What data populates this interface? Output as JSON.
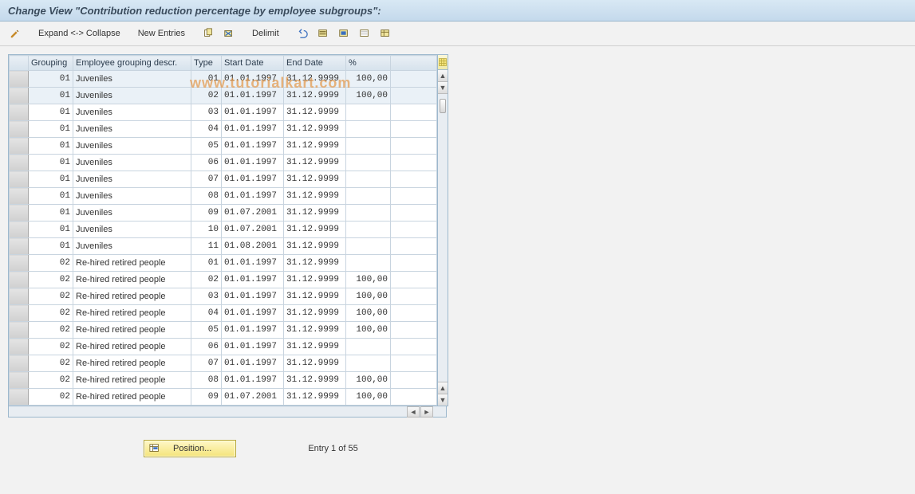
{
  "title": "Change View \"Contribution reduction percentage by employee subgroups\":",
  "watermark": "www.tutorialkart.com",
  "toolbar": {
    "expand_collapse": "Expand <-> Collapse",
    "new_entries": "New Entries",
    "delimit": "Delimit"
  },
  "columns": {
    "grouping": "Grouping",
    "descr": "Employee grouping descr.",
    "type": "Type",
    "start": "Start Date",
    "end": "End Date",
    "pct": "%"
  },
  "rows": [
    {
      "grp": "01",
      "descr": "Juveniles",
      "type": "01",
      "start": "01.01.1997",
      "end": "31.12.9999",
      "pct": "100,00"
    },
    {
      "grp": "01",
      "descr": "Juveniles",
      "type": "02",
      "start": "01.01.1997",
      "end": "31.12.9999",
      "pct": "100,00"
    },
    {
      "grp": "01",
      "descr": "Juveniles",
      "type": "03",
      "start": "01.01.1997",
      "end": "31.12.9999",
      "pct": ""
    },
    {
      "grp": "01",
      "descr": "Juveniles",
      "type": "04",
      "start": "01.01.1997",
      "end": "31.12.9999",
      "pct": ""
    },
    {
      "grp": "01",
      "descr": "Juveniles",
      "type": "05",
      "start": "01.01.1997",
      "end": "31.12.9999",
      "pct": ""
    },
    {
      "grp": "01",
      "descr": "Juveniles",
      "type": "06",
      "start": "01.01.1997",
      "end": "31.12.9999",
      "pct": ""
    },
    {
      "grp": "01",
      "descr": "Juveniles",
      "type": "07",
      "start": "01.01.1997",
      "end": "31.12.9999",
      "pct": ""
    },
    {
      "grp": "01",
      "descr": "Juveniles",
      "type": "08",
      "start": "01.01.1997",
      "end": "31.12.9999",
      "pct": ""
    },
    {
      "grp": "01",
      "descr": "Juveniles",
      "type": "09",
      "start": "01.07.2001",
      "end": "31.12.9999",
      "pct": ""
    },
    {
      "grp": "01",
      "descr": "Juveniles",
      "type": "10",
      "start": "01.07.2001",
      "end": "31.12.9999",
      "pct": ""
    },
    {
      "grp": "01",
      "descr": "Juveniles",
      "type": "11",
      "start": "01.08.2001",
      "end": "31.12.9999",
      "pct": ""
    },
    {
      "grp": "02",
      "descr": "Re-hired retired people",
      "type": "01",
      "start": "01.01.1997",
      "end": "31.12.9999",
      "pct": ""
    },
    {
      "grp": "02",
      "descr": "Re-hired retired people",
      "type": "02",
      "start": "01.01.1997",
      "end": "31.12.9999",
      "pct": "100,00"
    },
    {
      "grp": "02",
      "descr": "Re-hired retired people",
      "type": "03",
      "start": "01.01.1997",
      "end": "31.12.9999",
      "pct": "100,00"
    },
    {
      "grp": "02",
      "descr": "Re-hired retired people",
      "type": "04",
      "start": "01.01.1997",
      "end": "31.12.9999",
      "pct": "100,00"
    },
    {
      "grp": "02",
      "descr": "Re-hired retired people",
      "type": "05",
      "start": "01.01.1997",
      "end": "31.12.9999",
      "pct": "100,00"
    },
    {
      "grp": "02",
      "descr": "Re-hired retired people",
      "type": "06",
      "start": "01.01.1997",
      "end": "31.12.9999",
      "pct": ""
    },
    {
      "grp": "02",
      "descr": "Re-hired retired people",
      "type": "07",
      "start": "01.01.1997",
      "end": "31.12.9999",
      "pct": ""
    },
    {
      "grp": "02",
      "descr": "Re-hired retired people",
      "type": "08",
      "start": "01.01.1997",
      "end": "31.12.9999",
      "pct": "100,00"
    },
    {
      "grp": "02",
      "descr": "Re-hired retired people",
      "type": "09",
      "start": "01.07.2001",
      "end": "31.12.9999",
      "pct": "100,00"
    }
  ],
  "footer": {
    "position_label": "Position...",
    "entry_text": "Entry 1 of 55"
  }
}
